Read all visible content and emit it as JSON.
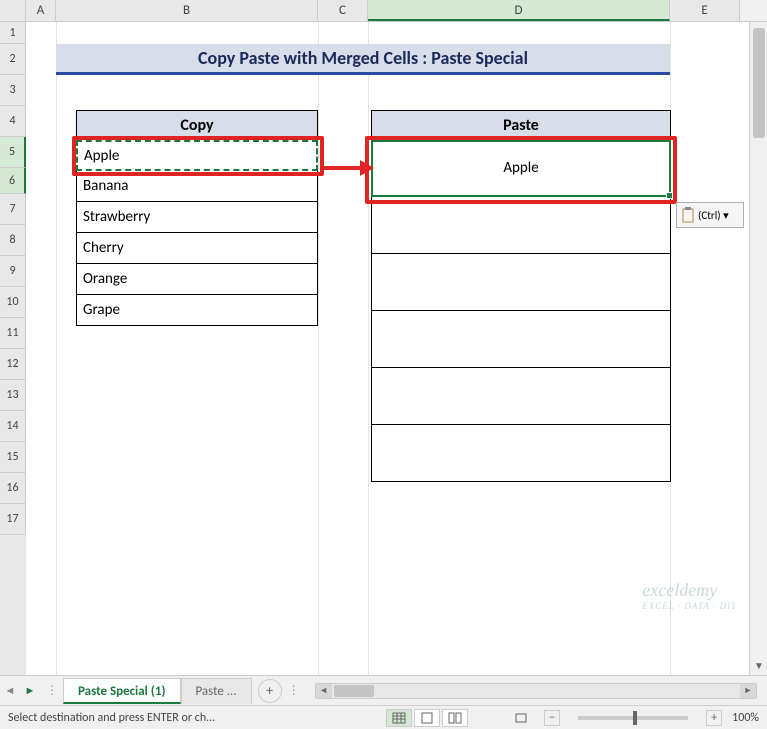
{
  "columns": [
    "A",
    "B",
    "C",
    "D",
    "E"
  ],
  "rows": [
    "1",
    "2",
    "3",
    "4",
    "5",
    "6",
    "7",
    "8",
    "9",
    "10",
    "11",
    "12",
    "13",
    "14",
    "15",
    "16",
    "17"
  ],
  "active_col": "D",
  "active_rows": [
    "5",
    "6"
  ],
  "title": "Copy Paste with Merged Cells : Paste Special",
  "copy": {
    "header": "Copy",
    "items": [
      "Apple",
      "Banana",
      "Strawberry",
      "Cherry",
      "Orange",
      "Grape"
    ]
  },
  "paste": {
    "header": "Paste",
    "merged_value": "Apple",
    "empty_rows": 5
  },
  "paste_button": "(Ctrl) ▾",
  "tabs": {
    "active": "Paste Special (1)",
    "other": "Paste ..."
  },
  "status": "Select destination and press ENTER or ch...",
  "zoom": "100%"
}
